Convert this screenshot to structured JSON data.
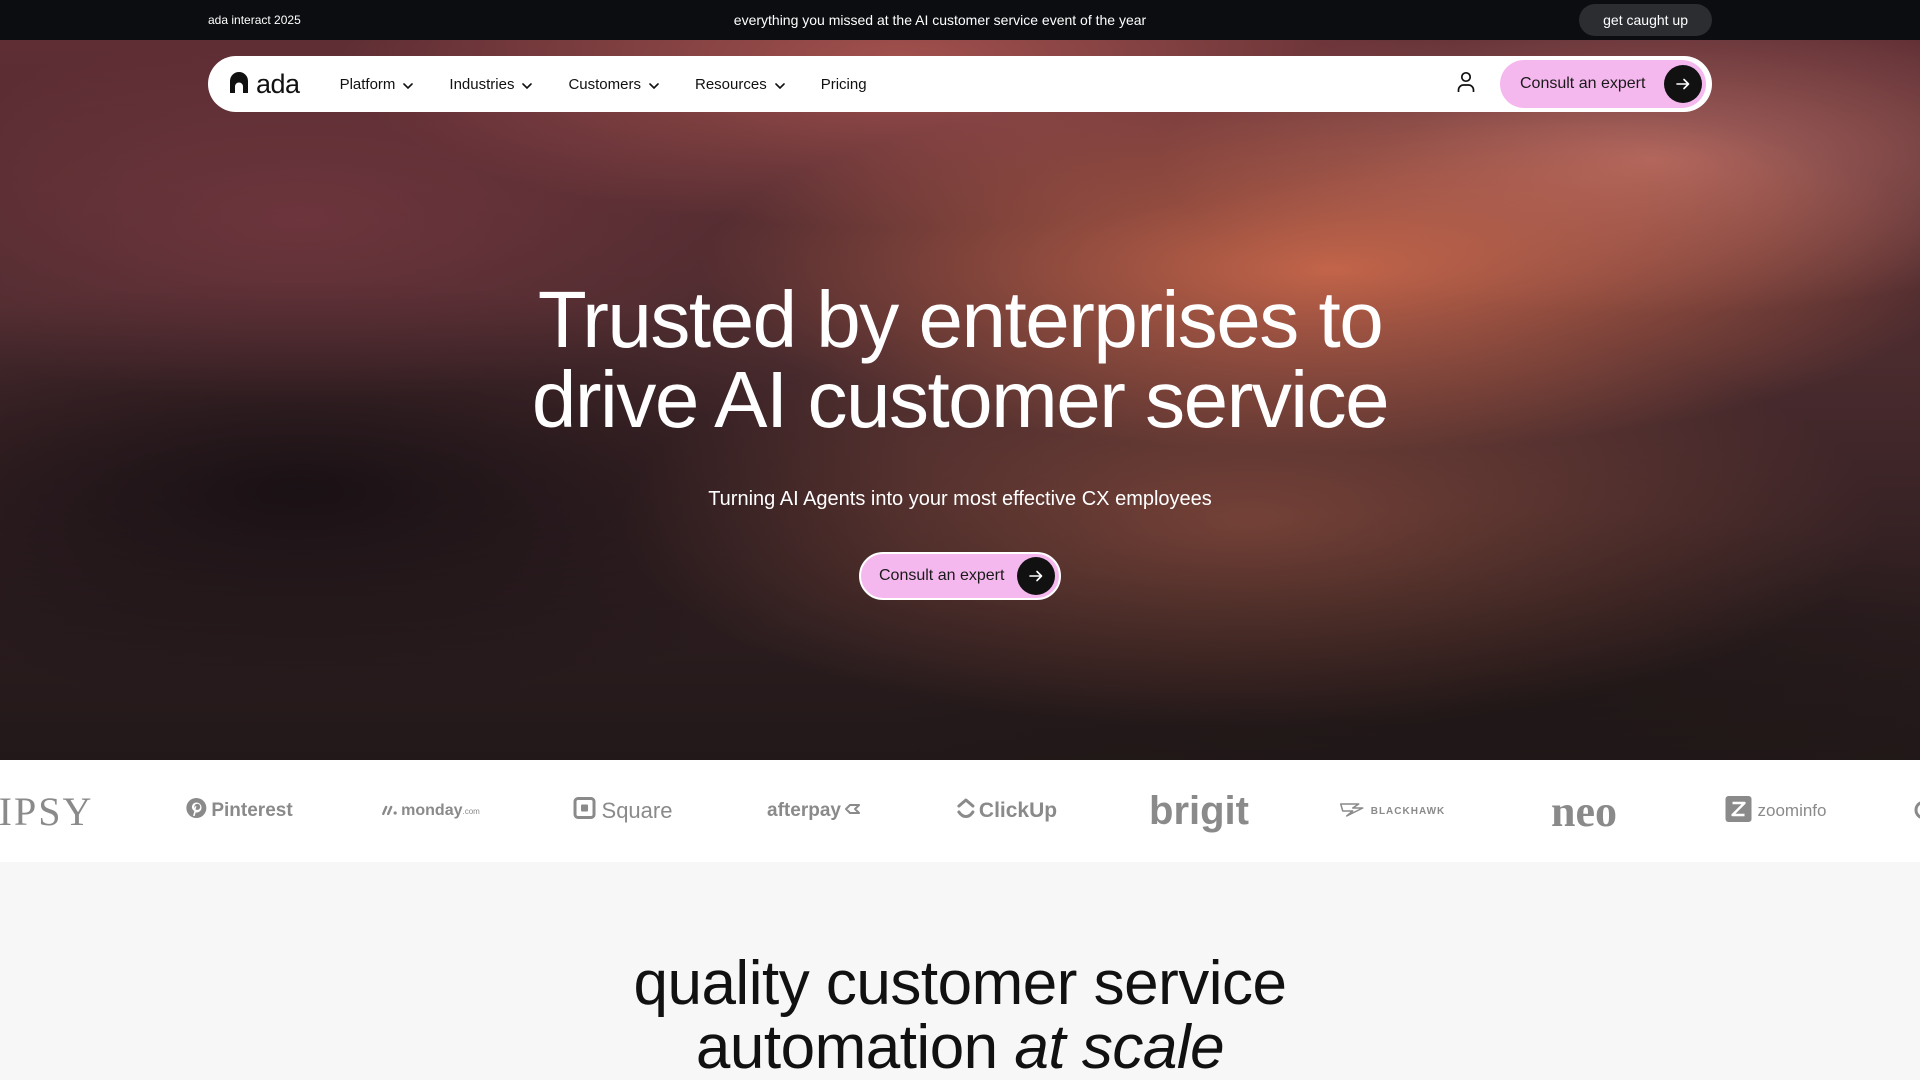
{
  "announcement": {
    "left_text": "ada interact 2025",
    "center_text": "everything you missed at the AI customer service event of the year",
    "button_label": "get caught up"
  },
  "nav": {
    "logo_text": "ada",
    "items": [
      {
        "label": "Platform",
        "has_dropdown": true
      },
      {
        "label": "Industries",
        "has_dropdown": true
      },
      {
        "label": "Customers",
        "has_dropdown": true
      },
      {
        "label": "Resources",
        "has_dropdown": true
      },
      {
        "label": "Pricing",
        "has_dropdown": false
      }
    ],
    "user_icon": "user-icon",
    "cta_label": "Consult an expert"
  },
  "hero": {
    "title_line1": "Trusted by enterprises to",
    "title_line2": "drive AI customer service",
    "subtitle": "Turning AI Agents into your most effective CX employees",
    "cta_label": "Consult an expert"
  },
  "logos": [
    {
      "name": "IPSY",
      "text": "IPSY"
    },
    {
      "name": "Pinterest",
      "text": "Pinterest"
    },
    {
      "name": "monday.com",
      "text": "monday",
      "suffix": ".com"
    },
    {
      "name": "Square",
      "text": "Square"
    },
    {
      "name": "afterpay",
      "text": "afterpay"
    },
    {
      "name": "ClickUp",
      "text": "ClickUp"
    },
    {
      "name": "brigit",
      "text": "brigit"
    },
    {
      "name": "Blackhawk",
      "text": "BLACKHAWK"
    },
    {
      "name": "neo",
      "text": "neo"
    },
    {
      "name": "zoominfo",
      "text": "zoominfo"
    }
  ],
  "section2": {
    "title_line1": "quality customer service",
    "title_line2_plain": "automation ",
    "title_line2_italic": "at scale"
  },
  "colors": {
    "accent_pink": "#f5b8ee",
    "dark": "#0b0d10",
    "logo_gray": "#8a8a8a"
  }
}
